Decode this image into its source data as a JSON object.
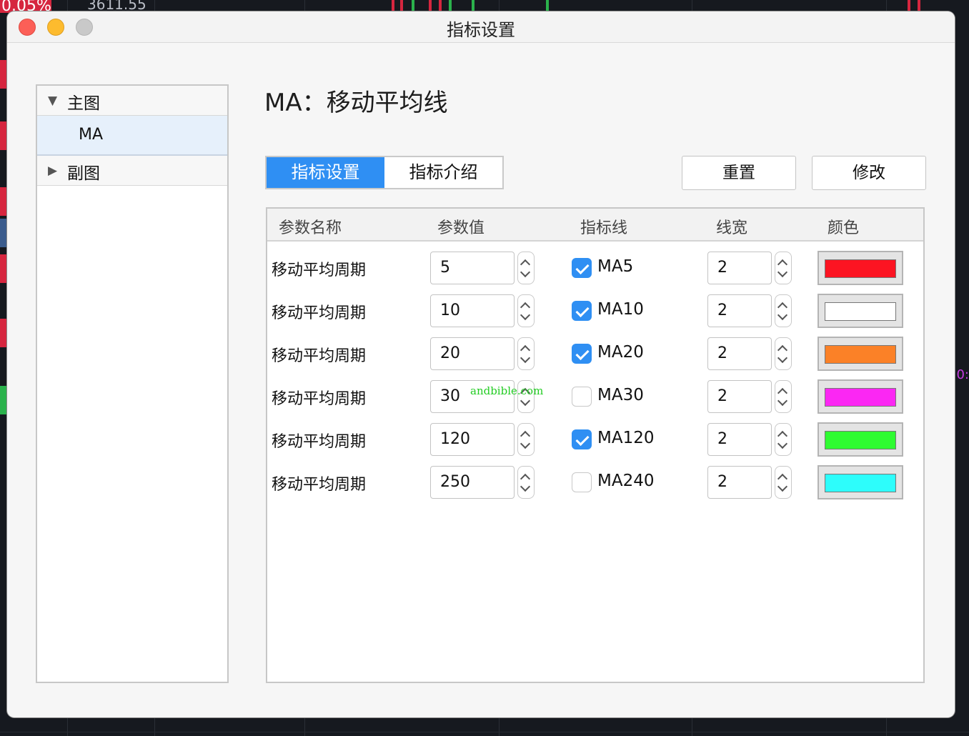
{
  "background": {
    "percent_tag": "0.05%",
    "price": "3611.55",
    "right_label": "0:"
  },
  "window": {
    "title": "指标设置"
  },
  "tree": {
    "groups": [
      {
        "label": "主图",
        "expanded": true,
        "children": [
          "MA"
        ]
      },
      {
        "label": "副图",
        "expanded": false,
        "children": []
      }
    ],
    "selected": "MA"
  },
  "main": {
    "title": "MA：移动平均线",
    "tabs": [
      {
        "label": "指标设置",
        "active": true
      },
      {
        "label": "指标介绍",
        "active": false
      }
    ],
    "buttons": {
      "reset": "重置",
      "modify": "修改"
    }
  },
  "table": {
    "headers": [
      "参数名称",
      "参数值",
      "指标线",
      "线宽",
      "颜色"
    ],
    "rows": [
      {
        "name": "移动平均周期",
        "value": "5",
        "line": "MA5",
        "checked": true,
        "width": "2",
        "color": "#fc1422"
      },
      {
        "name": "移动平均周期",
        "value": "10",
        "line": "MA10",
        "checked": true,
        "width": "2",
        "color": "#ffffff"
      },
      {
        "name": "移动平均周期",
        "value": "20",
        "line": "MA20",
        "checked": true,
        "width": "2",
        "color": "#fb8127"
      },
      {
        "name": "移动平均周期",
        "value": "30",
        "line": "MA30",
        "checked": false,
        "width": "2",
        "color": "#fb27f3"
      },
      {
        "name": "移动平均周期",
        "value": "120",
        "line": "MA120",
        "checked": true,
        "width": "2",
        "color": "#2ffc31"
      },
      {
        "name": "移动平均周期",
        "value": "250",
        "line": "MA240",
        "checked": false,
        "width": "2",
        "color": "#2dfdfb"
      }
    ]
  },
  "watermark": "andbible.com"
}
